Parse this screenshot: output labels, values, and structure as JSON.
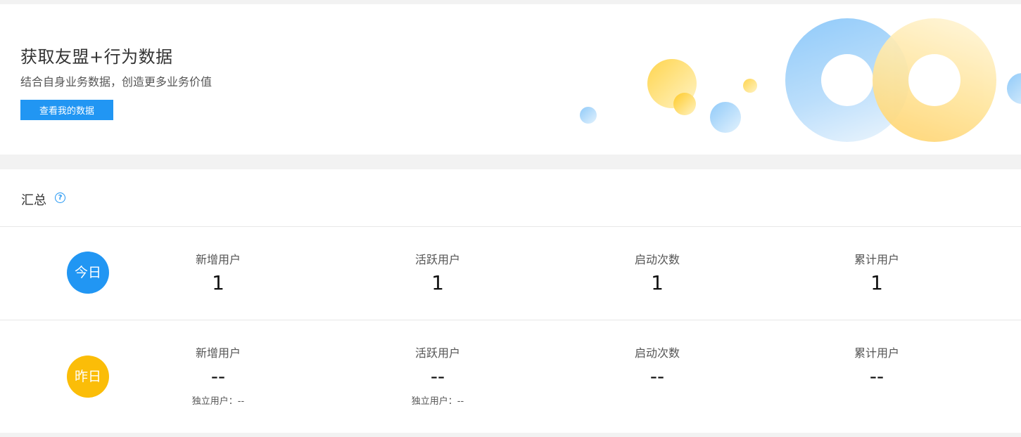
{
  "banner": {
    "title": "获取友盟+行为数据",
    "subtitle": "结合自身业务数据，创造更多业务价值",
    "button_label": "查看我的数据"
  },
  "summary": {
    "title": "汇总",
    "help_icon": "question-circle-icon",
    "rows": [
      {
        "badge": "今日",
        "badge_color": "#2196f3",
        "metrics": [
          {
            "label": "新增用户",
            "value": "1"
          },
          {
            "label": "活跃用户",
            "value": "1"
          },
          {
            "label": "启动次数",
            "value": "1"
          },
          {
            "label": "累计用户",
            "value": "1"
          }
        ]
      },
      {
        "badge": "昨日",
        "badge_color": "#fbbd08",
        "metrics": [
          {
            "label": "新增用户",
            "value": "--",
            "extra": "独立用户：--"
          },
          {
            "label": "活跃用户",
            "value": "--",
            "extra": "独立用户：--"
          },
          {
            "label": "启动次数",
            "value": "--"
          },
          {
            "label": "累计用户",
            "value": "--"
          }
        ]
      }
    ]
  },
  "colors": {
    "accent": "#2196f3",
    "yellow": "#fbbd08",
    "background": "#f2f2f2"
  }
}
